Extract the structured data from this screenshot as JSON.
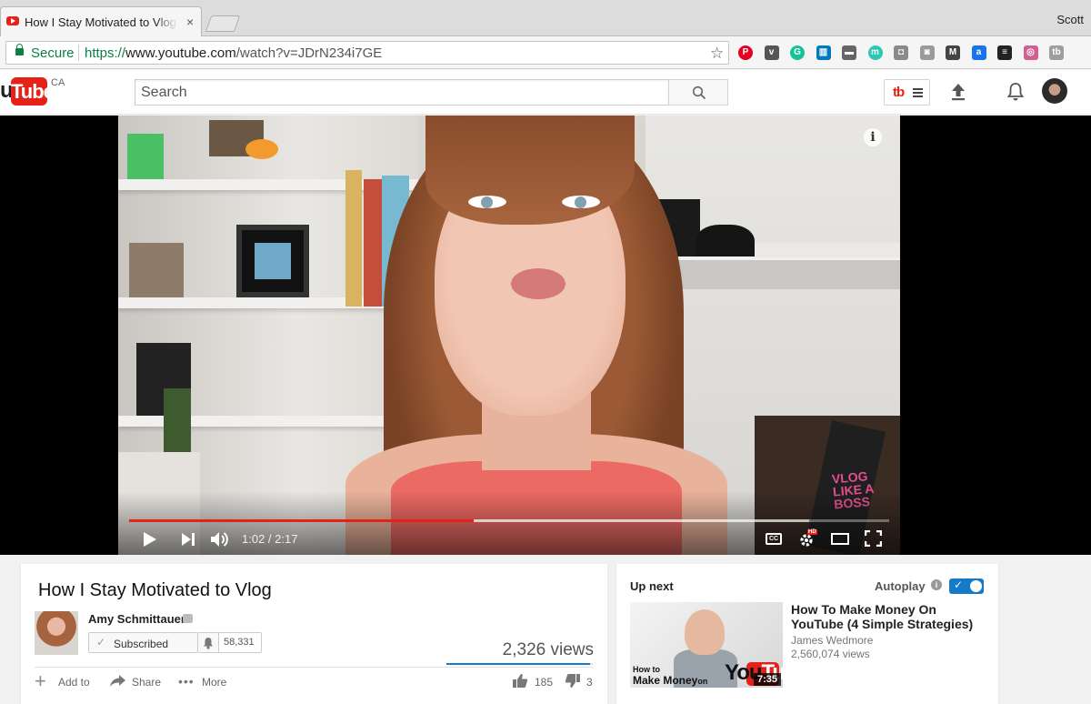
{
  "browser": {
    "tab_title": "How I Stay Motivated to Vlog",
    "tab_close": "×",
    "profile_name": "Scott",
    "secure_label": "Secure",
    "url_scheme": "https://",
    "url_host": "www.youtube.com",
    "url_path": "/watch?v=JDrN234i7GE",
    "extensions": [
      {
        "name": "pinterest-extension-icon",
        "color": "#e60023",
        "glyph": "P"
      },
      {
        "name": "pocket-extension-icon",
        "color": "#555555",
        "glyph": "v"
      },
      {
        "name": "grammarly-extension-icon",
        "color": "#15c39a",
        "glyph": "G"
      },
      {
        "name": "trello-extension-icon",
        "color": "#0079bf",
        "glyph": "▥"
      },
      {
        "name": "tag-extension-icon",
        "color": "#666666",
        "glyph": "▬"
      },
      {
        "name": "momentum-extension-icon",
        "color": "#2ac7b5",
        "glyph": "m"
      },
      {
        "name": "camera-extension-icon",
        "color": "#8a8a8a",
        "glyph": "◘"
      },
      {
        "name": "screenshot-extension-icon",
        "color": "#9a9a9a",
        "glyph": "◙"
      },
      {
        "name": "mailtrack-extension-icon",
        "color": "#444444",
        "glyph": "M"
      },
      {
        "name": "amazon-extension-icon",
        "color": "#1a73e8",
        "glyph": "a"
      },
      {
        "name": "buffer-extension-icon",
        "color": "#222222",
        "glyph": "≡"
      },
      {
        "name": "color-extension-icon",
        "color": "#d05f92",
        "glyph": "◎"
      },
      {
        "name": "tubebuddy-extension-icon",
        "color": "#9e9e9e",
        "glyph": "tb"
      }
    ]
  },
  "masthead": {
    "logo_u": "u",
    "logo_tube": "Tube",
    "logo_region": "CA",
    "search_placeholder": "Search"
  },
  "player": {
    "current_time": "1:02",
    "duration": "2:17",
    "time_display": "1:02 / 2:17",
    "progress_played": 0.453,
    "progress_loaded": 0.895,
    "watermark": "VLOG LIKE A BOSS",
    "hd_badge": "HD",
    "cc_label": "CC"
  },
  "video": {
    "title": "How I Stay Motivated to Vlog",
    "channel_name": "Amy Schmittauer",
    "subscribed_label": "Subscribed",
    "subscriber_count": "58,331",
    "views": "2,326 views",
    "like_ratio": 0.984,
    "actions": {
      "add_to": "Add to",
      "share": "Share",
      "more": "More"
    },
    "likes": "185",
    "dislikes": "3"
  },
  "upnext": {
    "label": "Up next",
    "autoplay_label": "Autoplay",
    "autoplay_on": true,
    "item": {
      "title": "How To Make Money On YouTube (4 Simple Strategies)",
      "channel": "James Wedmore",
      "views": "2,560,074 views",
      "duration": "7:35",
      "thumb_text_top": "How to",
      "thumb_text_main": "Make Money",
      "thumb_text_on": "on",
      "thumb_text_you": "You",
      "thumb_text_tube": "Tube"
    }
  },
  "colors": {
    "brand_red": "#e62117",
    "accent_blue": "#167ac6",
    "secure_green": "#0b8043"
  }
}
